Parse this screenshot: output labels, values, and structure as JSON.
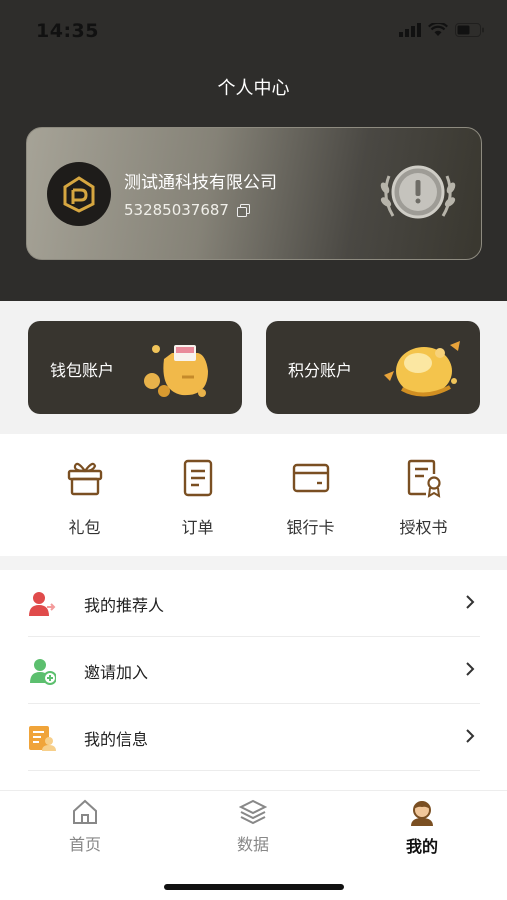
{
  "status_bar": {
    "time": "14:35"
  },
  "header": {
    "title": "个人中心"
  },
  "member_card": {
    "company_name": "测试通科技有限公司",
    "account_number": "53285037687"
  },
  "accounts": [
    {
      "label": "钱包账户"
    },
    {
      "label": "积分账户"
    }
  ],
  "shortcuts": [
    {
      "label": "礼包",
      "icon": "gift-icon"
    },
    {
      "label": "订单",
      "icon": "order-icon"
    },
    {
      "label": "银行卡",
      "icon": "bank-card-icon"
    },
    {
      "label": "授权书",
      "icon": "certificate-icon"
    }
  ],
  "menu": [
    {
      "label": "我的推荐人",
      "icon": "referrer-icon"
    },
    {
      "label": "邀请加入",
      "icon": "invite-icon"
    },
    {
      "label": "我的信息",
      "icon": "info-icon"
    }
  ],
  "tabbar": [
    {
      "label": "首页",
      "icon": "home-icon"
    },
    {
      "label": "数据",
      "icon": "layers-icon"
    },
    {
      "label": "我的",
      "icon": "profile-icon",
      "active": true
    }
  ],
  "colors": {
    "header_bg": "#2e2d2b",
    "accent_brown": "#7a4f22",
    "card_dark": "#38352f"
  }
}
